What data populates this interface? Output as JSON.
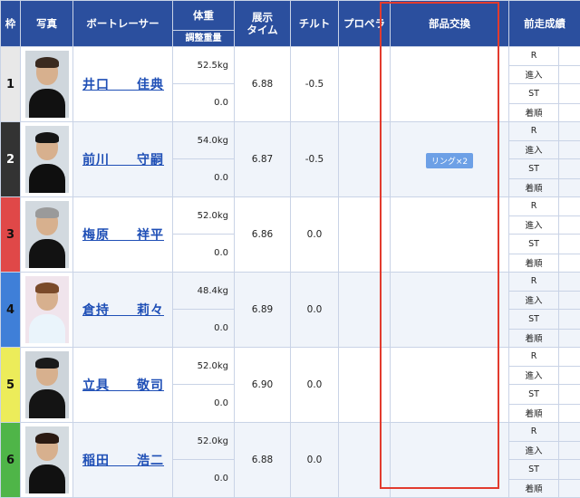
{
  "header": {
    "waku": "枠",
    "photo": "写真",
    "racer": "ボートレーサー",
    "weight": "体重",
    "adj_weight": "調整重量",
    "exhibition_time": "展示\nタイム",
    "tilt": "チルト",
    "propeller": "プロペラ",
    "parts": "部品交換",
    "prev_results": "前走成績"
  },
  "rows": [
    {
      "waku": "1",
      "waku_color": "#e8e8e8",
      "name": "井口　　佳典",
      "weight": "52.5kg",
      "adj": "0.0",
      "time": "6.88",
      "tilt": "-0.5",
      "parts": "",
      "hair": "#3a2a1f",
      "bg": "#cfd6dc",
      "body": "#111"
    },
    {
      "waku": "2",
      "waku_color": "#333333",
      "name": "前川　　守嗣",
      "weight": "54.0kg",
      "adj": "0.0",
      "time": "6.87",
      "tilt": "-0.5",
      "parts": "リング×2",
      "hair": "#151515",
      "bg": "#d6dde3",
      "body": "#0f0f0f"
    },
    {
      "waku": "3",
      "waku_color": "#e04848",
      "name": "梅原　　祥平",
      "weight": "52.0kg",
      "adj": "0.0",
      "time": "6.86",
      "tilt": "0.0",
      "parts": "",
      "hair": "#9a9a9a",
      "bg": "#d2d9df",
      "body": "#121212"
    },
    {
      "waku": "4",
      "waku_color": "#3f7fd8",
      "name": "倉持　　莉々",
      "weight": "48.4kg",
      "adj": "0.0",
      "time": "6.89",
      "tilt": "0.0",
      "parts": "",
      "hair": "#7a4a2a",
      "bg": "#f0e4ec",
      "body": "#eaf4fb"
    },
    {
      "waku": "5",
      "waku_color": "#ecec5a",
      "name": "立具　　敬司",
      "weight": "52.0kg",
      "adj": "0.0",
      "time": "6.90",
      "tilt": "0.0",
      "parts": "",
      "hair": "#1a1a1a",
      "bg": "#cdd4da",
      "body": "#141414"
    },
    {
      "waku": "6",
      "waku_color": "#4fb548",
      "name": "稲田　　浩二",
      "weight": "52.0kg",
      "adj": "0.0",
      "time": "6.88",
      "tilt": "0.0",
      "parts": "",
      "hair": "#2a1a12",
      "bg": "#d4dbe0",
      "body": "#111"
    }
  ],
  "rec_labels": [
    "R",
    "進入",
    "ST",
    "着順"
  ]
}
